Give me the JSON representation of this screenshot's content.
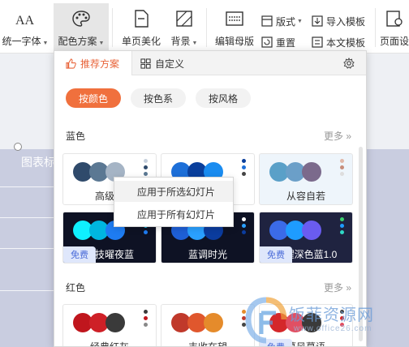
{
  "ribbon": {
    "unify_font": "统一字体",
    "color_scheme": "配色方案",
    "single_page_beautify": "单页美化",
    "background": "背景",
    "edit_master": "编辑母版",
    "layout": "版式",
    "reset": "重置",
    "import_template": "导入模板",
    "text_template": "本文模板",
    "page_settings": "页面设"
  },
  "slide": {
    "title": "图表标"
  },
  "popup": {
    "tabs": {
      "recommended": "推荐方案",
      "custom": "自定义"
    },
    "chips": {
      "by_color": "按颜色",
      "by_hue": "按色系",
      "by_style": "按风格"
    },
    "blue_section": {
      "title": "蓝色",
      "more": "更多 »"
    },
    "red_section": {
      "title": "红色",
      "more": "更多 »"
    },
    "cards": [
      {
        "name": "高级蓝",
        "circles": [
          "#2f4a6b",
          "#5b7893",
          "#a5b4c5"
        ],
        "dots": [
          "#c6d0dc",
          "#2f4a6b",
          "#5b7893"
        ],
        "free": ""
      },
      {
        "name": "",
        "circles": [
          "#1d6fd8",
          "#0a3f9c",
          "#1a8cf0"
        ],
        "dots": [
          "#0a3f9c",
          "#1d6fd8",
          "#444444"
        ],
        "free": ""
      },
      {
        "name": "从容自若",
        "circles": [
          "#5aa0c8",
          "#6b9fc8",
          "#7b6a8c"
        ],
        "dots": [
          "#e0b7a8",
          "#c78d7a",
          "#dddddd"
        ],
        "free": ""
      },
      {
        "name": "科技曜夜蓝",
        "circles": [
          "#0ff0ff",
          "#00b6e0",
          "#1e7cf2"
        ],
        "dots": [
          "#333333",
          "#12c2e9",
          "#1e7cf2"
        ],
        "free": "免费"
      },
      {
        "name": "蓝调时光",
        "circles": [
          "#1e5fd6",
          "#2aa0ff",
          "#0b3c9e"
        ],
        "dots": [
          "#ffffff",
          "#2aa0ff",
          "#0b3c9e"
        ],
        "free": ""
      },
      {
        "name": "闪耀深色蓝1.0",
        "circles": [
          "#3b6be8",
          "#1e9cff",
          "#6a5cf0"
        ],
        "dots": [
          "#3bd16f",
          "#1e9cff",
          "#2fd9c6"
        ],
        "free": "免费"
      },
      {
        "name": "经典红灰",
        "circles": [
          "#c0161d",
          "#ce2027",
          "#3a3a3a"
        ],
        "dots": [
          "#3a3a3a",
          "#c0161d",
          "#888888"
        ],
        "free": ""
      },
      {
        "name": "丰收在望",
        "circles": [
          "#c0392b",
          "#e0572d",
          "#e58b2b"
        ],
        "dots": [
          "#e58b2b",
          "#c0392b",
          "#444444"
        ],
        "free": ""
      },
      {
        "name": "暮风暮语",
        "circles": [
          "#d4272a",
          "#e14f63",
          "#3a3a3a"
        ],
        "dots": [
          "#444444",
          "#d4272a",
          "#e14f63"
        ],
        "free": "免费"
      }
    ]
  },
  "context_menu": {
    "apply_selected": "应用于所选幻灯片",
    "apply_all": "应用于所有幻灯片"
  },
  "watermark": {
    "text": "饭菲资源网",
    "url": "www.office26.com"
  }
}
